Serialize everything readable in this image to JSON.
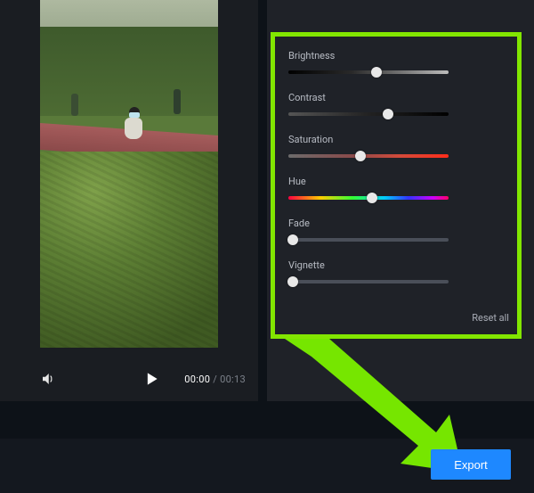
{
  "player": {
    "current_time": "00:00",
    "duration": "00:13",
    "separator": " / "
  },
  "adjust": {
    "brightness": {
      "label": "Brightness",
      "value": 55
    },
    "contrast": {
      "label": "Contrast",
      "value": 62
    },
    "saturation": {
      "label": "Saturation",
      "value": 45
    },
    "hue": {
      "label": "Hue",
      "value": 52
    },
    "fade": {
      "label": "Fade",
      "value": 3
    },
    "vignette": {
      "label": "Vignette",
      "value": 3
    },
    "reset_label": "Reset all"
  },
  "export_label": "Export"
}
